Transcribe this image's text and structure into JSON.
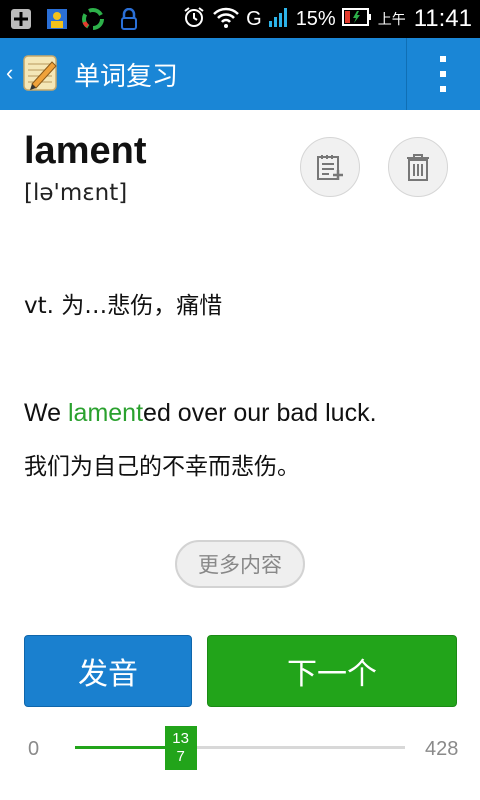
{
  "status_bar": {
    "battery_percent": "15%",
    "time_prefix": "上午",
    "time": "11:41",
    "network_label": "G",
    "icons": [
      "add-box-icon",
      "contacts-icon",
      "recycle-icon",
      "phone-lock-icon",
      "alarm-icon",
      "wifi-icon",
      "signal-icon",
      "battery-low-icon"
    ]
  },
  "action_bar": {
    "back_glyph": "‹",
    "title": "单词复习",
    "menu_icon": "overflow-menu-icon",
    "color": "#1a86d6"
  },
  "word": {
    "text": "lament",
    "phonetic": "[lə'mɛnt]"
  },
  "actions": {
    "add_icon": "add-to-notebook-icon",
    "delete_icon": "trash-icon"
  },
  "meaning": "vt. 为…悲伤，痛惜",
  "example": {
    "en_highlight": "lament",
    "en_rest": "ed over our bad luck.",
    "en_prefix": "We ",
    "zh": "我们为自己的不幸而悲伤。"
  },
  "more_button": "更多内容",
  "buttons": {
    "speak": "发音",
    "next": "下一个",
    "speak_color": "#1a80cf",
    "next_color": "#22a41a"
  },
  "progress": {
    "min": "0",
    "max": "428",
    "current": 137,
    "current_label_line1": "13",
    "current_label_line2": "7"
  },
  "colors": {
    "highlight": "#2aa12e"
  }
}
